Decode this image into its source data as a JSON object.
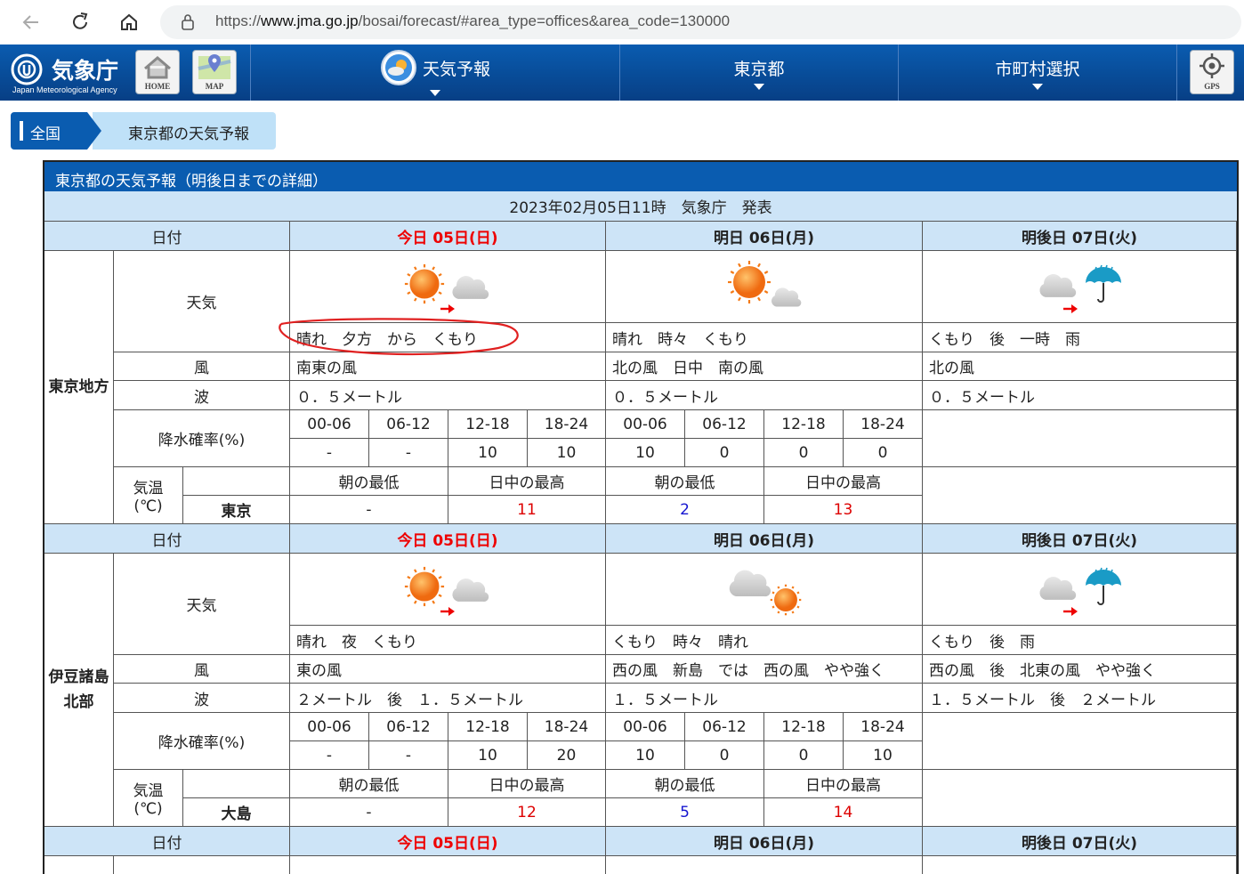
{
  "browser": {
    "url_prefix": "https://",
    "url_domain": "www.jma.go.jp",
    "url_path": "/bosai/forecast/#area_type=offices&area_code=130000"
  },
  "header": {
    "logo_text": "気象庁",
    "logo_sub": "Japan Meteorological Agency",
    "home_label": "HOME",
    "map_label": "MAP",
    "menu": [
      "天気予報",
      "東京都",
      "市町村選択"
    ],
    "gps_label": "GPS"
  },
  "breadcrumb": {
    "home": "全国",
    "current": "東京都の天気予報"
  },
  "forecast": {
    "title": "東京都の天気予報（明後日までの詳細）",
    "published": "2023年02月05日11時　気象庁　発表",
    "date_header": "日付",
    "days": [
      "今日 05日(日)",
      "明日 06日(月)",
      "明後日 07日(火)"
    ],
    "row_labels": {
      "weather": "天気",
      "wind": "風",
      "wave": "波",
      "pop": "降水確率(%)",
      "temp_1": "気温",
      "temp_2": "(℃)"
    },
    "pop_periods": [
      "00-06",
      "06-12",
      "12-18",
      "18-24"
    ],
    "temp_labels": [
      "朝の最低",
      "日中の最高"
    ],
    "areas": [
      {
        "name": "東京地方",
        "station": "東京",
        "weather": [
          "晴れ　夕方　から　くもり",
          "晴れ　時々　くもり",
          "くもり　後　一時　雨"
        ],
        "wind": [
          "南東の風",
          "北の風　日中　南の風",
          "北の風"
        ],
        "wave": [
          "０．５メートル",
          "０．５メートル",
          "０．５メートル"
        ],
        "pop_today": [
          "-",
          "-",
          "10",
          "10"
        ],
        "pop_tomorrow": [
          "10",
          "0",
          "0",
          "0"
        ],
        "temp": [
          "-",
          "11",
          "2",
          "13"
        ]
      },
      {
        "name": "伊豆諸島北部",
        "station": "大島",
        "weather": [
          "晴れ　夜　くもり",
          "くもり　時々　晴れ",
          "くもり　後　雨"
        ],
        "wind": [
          "東の風",
          "西の風　新島　では　西の風　やや強く",
          "西の風　後　北東の風　やや強く"
        ],
        "wave": [
          "２メートル　後　１．５メートル",
          "１．５メートル",
          "１．５メートル　後　２メートル"
        ],
        "pop_today": [
          "-",
          "-",
          "10",
          "20"
        ],
        "pop_tomorrow": [
          "10",
          "0",
          "0",
          "10"
        ],
        "temp": [
          "-",
          "12",
          "5",
          "14"
        ]
      }
    ]
  }
}
